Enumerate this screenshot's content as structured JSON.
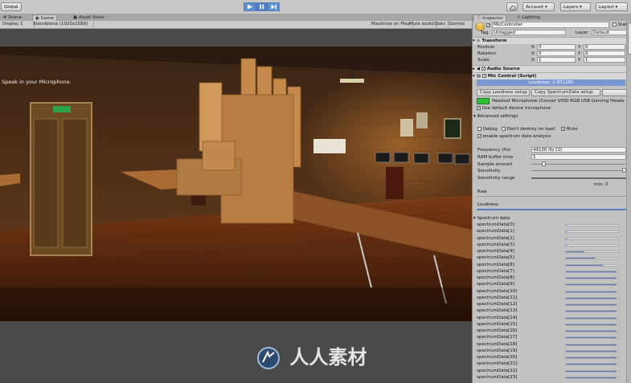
{
  "toolbar": {
    "global_label": "Global",
    "account_label": "Account",
    "layers_label": "Layers",
    "layout_label": "Layout"
  },
  "scene_tabs": {
    "scene": "Scene",
    "game": "Game",
    "asset_store": "Asset Store"
  },
  "game_bar": {
    "display": "Display 1",
    "resolution": "Standalone (1920x1080)",
    "maximize_on_play": "Maximize on Play",
    "mute_audio": "Mute audio",
    "stats": "Stats",
    "gizmos": "Gizmos"
  },
  "viewport": {
    "prompt": "Speak in your Microphone."
  },
  "watermark": {
    "text": "人人素材"
  },
  "inspector": {
    "tab_inspector": "Inspector",
    "tab_lighting": "Lighting",
    "object_name": "MicController",
    "static_label": "Static",
    "tag_label": "Tag",
    "tag_value": "Untagged",
    "layer_label": "Layer",
    "layer_value": "Default",
    "transform": {
      "title": "Transform",
      "rows": [
        {
          "label": "Position",
          "x": "0",
          "y": "0"
        },
        {
          "label": "Rotation",
          "x": "0",
          "y": "0"
        },
        {
          "label": "Scale",
          "x": "1",
          "y": "1"
        }
      ]
    },
    "audio_source_title": "Audio Source",
    "mic_control": {
      "title": "Mic Control (Script)",
      "loudness_readout": "Loudness: 2.951295",
      "copy_loudness": "Copy Loudness setup",
      "copy_spectrum": "Copy SpectrumData setup",
      "device": "Headset Microphone (Corsair VOID RGB USB Gaming Headset)",
      "use_default": "Use default device microphone",
      "advanced": "Advanced settings",
      "debug": "Debug",
      "dont_destroy": "Don't destroy on load",
      "mute": "Mute",
      "enable_spectrum": "enable spectrum data analysis",
      "frequency_label": "Frequency (Hz)",
      "frequency_value": "44100 Hz CD",
      "ram_label": "RAM buffer time",
      "ram_value": "1",
      "sample_label": "Sample amount",
      "sensitivity_label": "Sensitivity",
      "sensitivity_range_label": "Sensitivity range",
      "min_label": "min: 0",
      "raw_label": "Raw",
      "loudness_label": "Loudness",
      "spectrum_title": "Spectrum data",
      "spectrum_rows": [
        {
          "label": "spectrumData[0]",
          "level": 0.02
        },
        {
          "label": "spectrumData[1]",
          "level": 0.02
        },
        {
          "label": "spectrumData[2]",
          "level": 0.02
        },
        {
          "label": "spectrumData[3]",
          "level": 0.02
        },
        {
          "label": "spectrumData[4]",
          "level": 0.35
        },
        {
          "label": "spectrumData[5]",
          "level": 0.55
        },
        {
          "label": "spectrumData[6]",
          "level": 0.7
        },
        {
          "label": "spectrumData[7]",
          "level": 0.95
        },
        {
          "label": "spectrumData[8]",
          "level": 0.95
        },
        {
          "label": "spectrumData[9]",
          "level": 0.95
        },
        {
          "label": "spectrumData[10]",
          "level": 0.95
        },
        {
          "label": "spectrumData[11]",
          "level": 0.95
        },
        {
          "label": "spectrumData[12]",
          "level": 0.95
        },
        {
          "label": "spectrumData[13]",
          "level": 0.95
        },
        {
          "label": "spectrumData[14]",
          "level": 0.95
        },
        {
          "label": "spectrumData[15]",
          "level": 0.95
        },
        {
          "label": "spectrumData[16]",
          "level": 0.95
        },
        {
          "label": "spectrumData[17]",
          "level": 0.95
        },
        {
          "label": "spectrumData[18]",
          "level": 0.95
        },
        {
          "label": "spectrumData[19]",
          "level": 0.95
        },
        {
          "label": "spectrumData[20]",
          "level": 0.95
        },
        {
          "label": "spectrumData[21]",
          "level": 0.95
        },
        {
          "label": "spectrumData[22]",
          "level": 0.95
        },
        {
          "label": "spectrumData[23]",
          "level": 0.95
        }
      ]
    }
  },
  "colors": {
    "accent": "#5b7dbb",
    "highlight_row": "#7b97d1",
    "device_green": "#2fbf3a"
  }
}
